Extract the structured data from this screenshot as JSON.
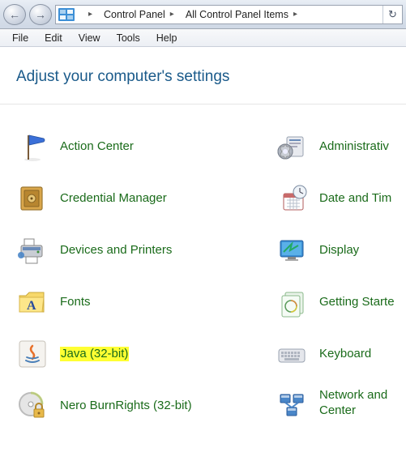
{
  "nav": {
    "back": "←",
    "forward": "→",
    "refresh": "↻"
  },
  "breadcrumb": {
    "items": [
      "Control Panel",
      "All Control Panel Items"
    ]
  },
  "menu": {
    "items": [
      "File",
      "Edit",
      "View",
      "Tools",
      "Help"
    ]
  },
  "heading": "Adjust your computer's settings",
  "items_left": [
    {
      "label": "Action Center",
      "icon": "flag",
      "highlighted": false
    },
    {
      "label": "Credential Manager",
      "icon": "safe",
      "highlighted": false
    },
    {
      "label": "Devices and Printers",
      "icon": "printer",
      "highlighted": false
    },
    {
      "label": "Fonts",
      "icon": "fonts-folder",
      "highlighted": false
    },
    {
      "label": "Java (32-bit)",
      "icon": "java",
      "highlighted": true
    },
    {
      "label": "Nero BurnRights (32-bit)",
      "icon": "disc-lock",
      "highlighted": false
    }
  ],
  "items_right": [
    {
      "label": "Administrativ",
      "icon": "admin-tools",
      "highlighted": false
    },
    {
      "label": "Date and Tim",
      "icon": "clock-calendar",
      "highlighted": false
    },
    {
      "label": "Display",
      "icon": "display",
      "highlighted": false
    },
    {
      "label": "Getting Starte",
      "icon": "getting-started",
      "highlighted": false
    },
    {
      "label": "Keyboard",
      "icon": "keyboard",
      "highlighted": false
    },
    {
      "label": "Network and\nCenter",
      "icon": "network",
      "highlighted": false
    }
  ]
}
